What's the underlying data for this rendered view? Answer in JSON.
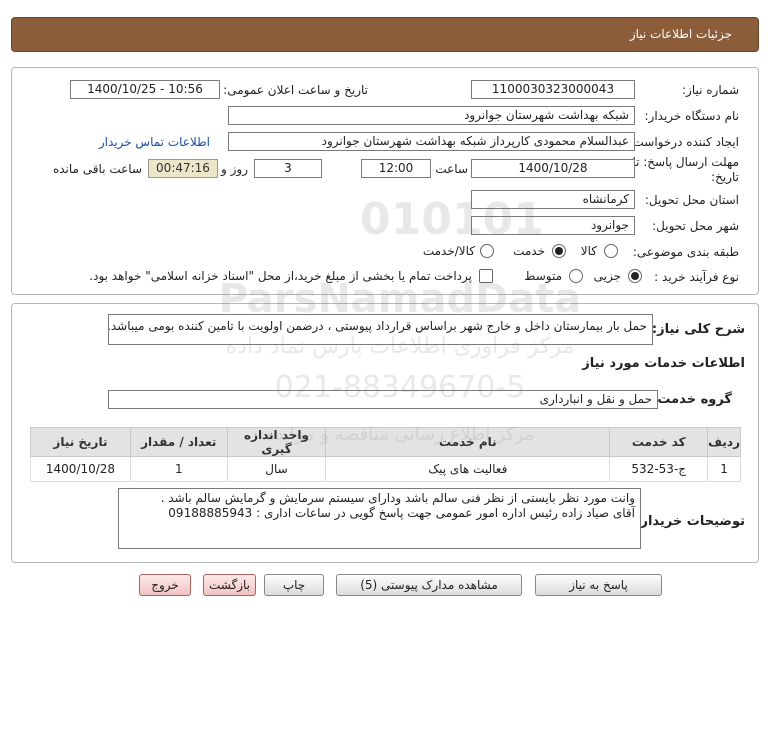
{
  "header": {
    "title": "جزئیات اطلاعات نیاز"
  },
  "form": {
    "need_number_label": "شماره نیاز:",
    "need_number": "1100030323000043",
    "announce_label": "تاریخ و ساعت اعلان عمومی:",
    "announce_value": "1400/10/25 - 10:56",
    "buyer_org_label": "نام دستگاه خریدار:",
    "buyer_org": "شبکه بهداشت شهرستان جوانرود",
    "creator_label": "ایجاد کننده درخواست:",
    "creator": "عبدالسلام محمودی کارپرداز شبکه بهداشت شهرستان جوانرود",
    "contact_link": "اطلاعات تماس خریدار",
    "deadline_label_line1": "مهلت ارسال پاسخ: تا",
    "deadline_label_line2": "تاریخ:",
    "deadline_date": "1400/10/28",
    "time_label": "ساعت",
    "deadline_time": "12:00",
    "days_label": "روز و",
    "days_value": "3",
    "remaining_time": "00:47:16",
    "remaining_label": "ساعت باقی مانده",
    "province_label": "استان محل تحویل:",
    "province": "کرمانشاه",
    "city_label": "شهر محل تحویل:",
    "city": "جوانرود",
    "category_label": "طبقه بندی موضوعی:",
    "category_options": [
      "کالا",
      "خدمت",
      "کالا/خدمت"
    ],
    "category_selected": "خدمت",
    "process_label": "نوع فرآیند خرید :",
    "process_options": [
      "جزیی",
      "متوسط"
    ],
    "process_selected": "جزیی",
    "payment_note": "پرداخت تمام یا بخشی از مبلغ خرید،از محل \"اسناد خزانه اسلامی\" خواهد بود."
  },
  "description": {
    "label": "شرح کلی نیاز:",
    "text": "حمل بار بیمارستان داخل و خارج شهر براساس قرارداد پیوستی ، درضمن اولویت با تامین کننده بومی میباشد."
  },
  "services": {
    "section_title": "اطلاعات خدمات مورد نیاز",
    "group_label": "گروه خدمت:",
    "group_value": "حمل و نقل و انبارداری",
    "columns": [
      "ردیف",
      "کد خدمت",
      "نام خدمت",
      "واحد اندازه گیری",
      "تعداد / مقدار",
      "تاریخ نیاز"
    ],
    "rows": [
      [
        "1",
        "ج-53-532",
        "فعالیت های پیک",
        "سال",
        "1",
        "1400/10/28"
      ]
    ]
  },
  "buyer_notes": {
    "label": "توضیحات خریدار:",
    "line1": "وانت مورد نظر بایستی از نظر فنی سالم باشد ودارای  سیستم سرمایش و گرمایش سالم باشد .",
    "line2": "آقای صیاد زاده رئیس اداره امور عمومی جهت پاسخ گویی در ساعات اداری : 09188885943"
  },
  "buttons": {
    "reply": "پاسخ به نیاز",
    "attachments": "مشاهده مدارک پیوستی (5)",
    "print": "چاپ",
    "back": "بازگشت",
    "exit": "خروج"
  },
  "watermark": {
    "line1": "ParsNamadData",
    "line2": "مرکز فراوری اطلاعات پارس نماد داده",
    "line3": "021-88349670-5",
    "line4": "مرکز اطلاع رسانی مناقصه و مزایده"
  },
  "colors": {
    "header_bg": "#8b5d3b",
    "timer_bg": "#ece7c9",
    "link": "#1a4fa0"
  }
}
